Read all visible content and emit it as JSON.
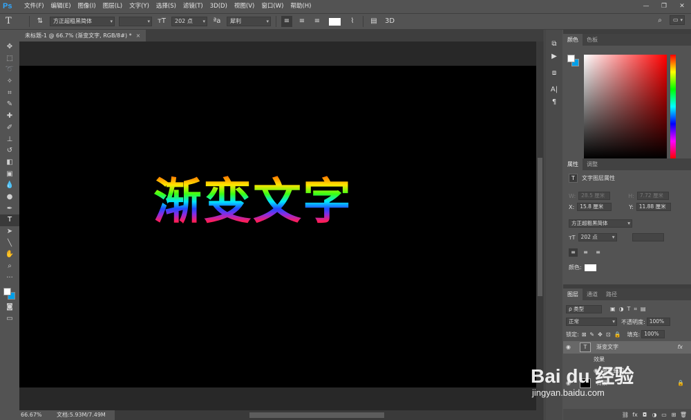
{
  "app": {
    "logo": "Ps"
  },
  "menu": [
    "文件(F)",
    "编辑(E)",
    "图像(I)",
    "图层(L)",
    "文字(Y)",
    "选择(S)",
    "滤镜(T)",
    "3D(D)",
    "视图(V)",
    "窗口(W)",
    "帮助(H)"
  ],
  "window_controls": {
    "minimize": "—",
    "maximize": "❐",
    "close": "✕"
  },
  "options": {
    "tool_glyph": "T",
    "font_family": "方正超粗黑简体",
    "font_style": "",
    "font_size": "202 点",
    "aa_label": "ªa",
    "antialias": "犀利",
    "threeD": "3D"
  },
  "document": {
    "tab_title": "未标题-1 @ 66.7% (渐变文字, RGB/8#) *",
    "close": "×",
    "text": "渐变文字"
  },
  "status": {
    "zoom": "66.67%",
    "doc_info": "文档:5.93M/7.49M"
  },
  "panels": {
    "color_tabs": [
      "颜色",
      "色板"
    ],
    "props_tabs": [
      "属性",
      "调整"
    ],
    "props_title": "文字图层属性",
    "w_label": "W:",
    "w_value": "28.5 厘米",
    "h_label": "H:",
    "h_value": "7.72 厘米",
    "x_label": "X:",
    "x_value": "15.8 厘米",
    "y_label": "Y:",
    "y_value": "11.88 厘米",
    "font_family": "方正超粗黑简体",
    "font_size": "202 点",
    "color_label": "颜色:",
    "layers_tabs": [
      "图层",
      "通道",
      "路径"
    ],
    "filter_kind": "ρ 类型",
    "blend_mode": "正常",
    "opacity_label": "不透明度:",
    "opacity_value": "100%",
    "lock_label": "锁定:",
    "fill_label": "填充:",
    "fill_value": "100%",
    "layer_text": "渐变文字",
    "layer_effects": "效果",
    "layer_effect_item": "渐变叠加",
    "layer_bg": "背景",
    "fx": "fx"
  },
  "watermark": {
    "logo": "Bai du 经验",
    "url": "jingyan.baidu.com"
  }
}
